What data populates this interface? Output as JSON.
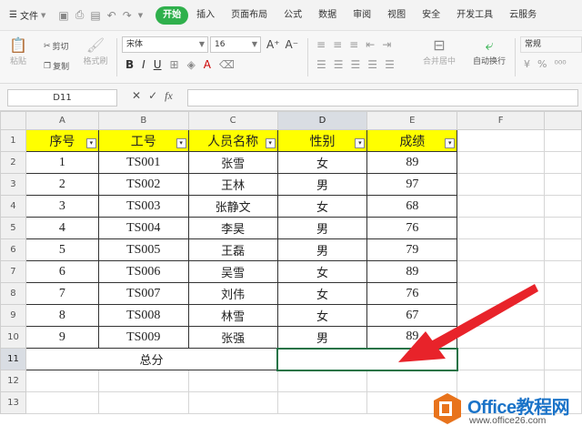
{
  "menubar": {
    "file_label": "文件",
    "tabs": [
      "开始",
      "插入",
      "页面布局",
      "公式",
      "数据",
      "审阅",
      "视图",
      "安全",
      "开发工具",
      "云服务"
    ],
    "active_tab": "开始"
  },
  "ribbon": {
    "paste": "粘贴",
    "cut": "剪切",
    "copy": "复制",
    "format_painter": "格式刷",
    "font_name": "宋体",
    "font_size": "16",
    "merge_center": "合并居中",
    "wrap_text": "自动换行",
    "number_format": "常规"
  },
  "formula_bar": {
    "name_box": "D11",
    "fx": "fx",
    "value": ""
  },
  "sheet": {
    "columns": [
      "A",
      "B",
      "C",
      "D",
      "E",
      "F"
    ],
    "rows": [
      "1",
      "2",
      "3",
      "4",
      "5",
      "6",
      "7",
      "8",
      "9",
      "10",
      "11",
      "12",
      "13"
    ],
    "headers": [
      "序号",
      "工号",
      "人员名称",
      "性别",
      "成绩"
    ],
    "data": [
      [
        "1",
        "TS001",
        "张雪",
        "女",
        "89"
      ],
      [
        "2",
        "TS002",
        "王林",
        "男",
        "97"
      ],
      [
        "3",
        "TS003",
        "张静文",
        "女",
        "68"
      ],
      [
        "4",
        "TS004",
        "李昊",
        "男",
        "76"
      ],
      [
        "5",
        "TS005",
        "王磊",
        "男",
        "79"
      ],
      [
        "6",
        "TS006",
        "吴雪",
        "女",
        "89"
      ],
      [
        "7",
        "TS007",
        "刘伟",
        "女",
        "76"
      ],
      [
        "8",
        "TS008",
        "林雪",
        "女",
        "67"
      ],
      [
        "9",
        "TS009",
        "张强",
        "男",
        "89"
      ]
    ],
    "total_label": "总分",
    "total_value": ""
  },
  "watermark": {
    "title": "Office教程网",
    "url": "www.office26.com"
  },
  "colors": {
    "accent": "#2fb04c",
    "header_fill": "#ffff00",
    "arrow": "#e8232a",
    "selection": "#217346"
  }
}
